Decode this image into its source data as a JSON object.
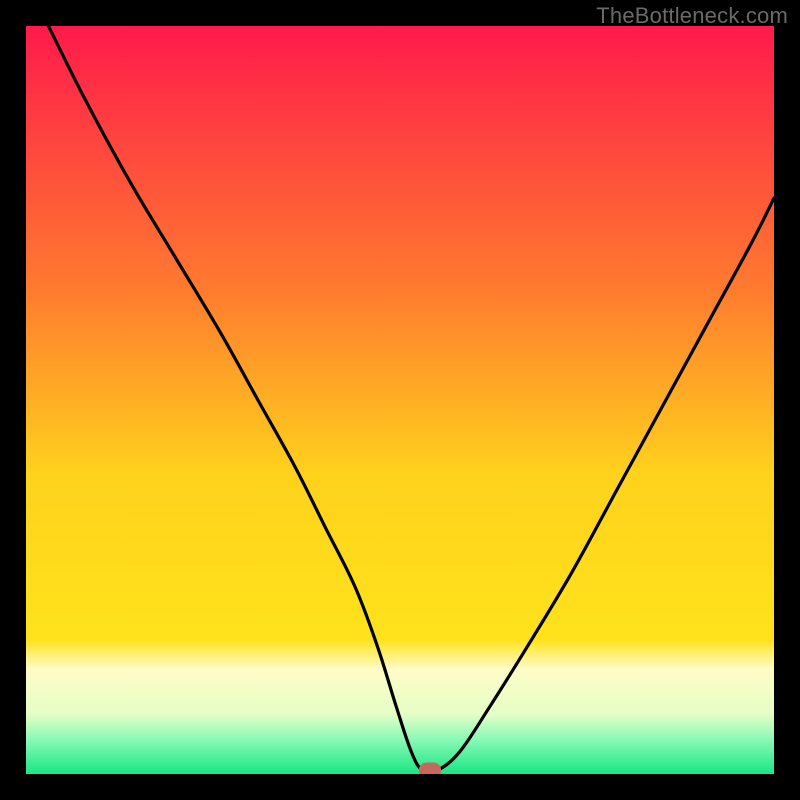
{
  "watermark": "TheBottleneck.com",
  "colors": {
    "frame": "#000000",
    "top": "#ff1a4b",
    "mid": "#ffe21c",
    "paleband_top": "#fffcc7",
    "paleband_bot": "#e4ffc6",
    "green_light": "#86f9b5",
    "green": "#19e683",
    "curve": "#000000",
    "marker": "#c5695f"
  },
  "chart_data": {
    "type": "line",
    "title": "",
    "xlabel": "",
    "ylabel": "",
    "xlim": [
      0,
      100
    ],
    "ylim": [
      0,
      100
    ],
    "series": [
      {
        "name": "bottleneck-curve",
        "x": [
          3,
          8,
          14,
          20,
          26,
          31,
          36,
          40,
          44,
          47,
          49.5,
          51.5,
          53,
          55,
          58,
          62,
          67,
          73,
          79,
          85,
          91,
          97,
          100
        ],
        "y": [
          100,
          90,
          79,
          69,
          59,
          50,
          41,
          33,
          25,
          17,
          9,
          3,
          0.5,
          0.5,
          3,
          9,
          17,
          27,
          38,
          49,
          60,
          71,
          77
        ]
      }
    ],
    "marker": {
      "x": 54,
      "y": 0.6
    },
    "gradient_stops": [
      {
        "offset": 0.0,
        "color": "#ff1a4b"
      },
      {
        "offset": 0.35,
        "color": "#ff7a2f"
      },
      {
        "offset": 0.6,
        "color": "#ffd21c"
      },
      {
        "offset": 0.82,
        "color": "#ffe21c"
      },
      {
        "offset": 0.86,
        "color": "#fffcc7"
      },
      {
        "offset": 0.92,
        "color": "#e4ffc6"
      },
      {
        "offset": 0.955,
        "color": "#86f9b5"
      },
      {
        "offset": 1.0,
        "color": "#19e683"
      }
    ]
  }
}
